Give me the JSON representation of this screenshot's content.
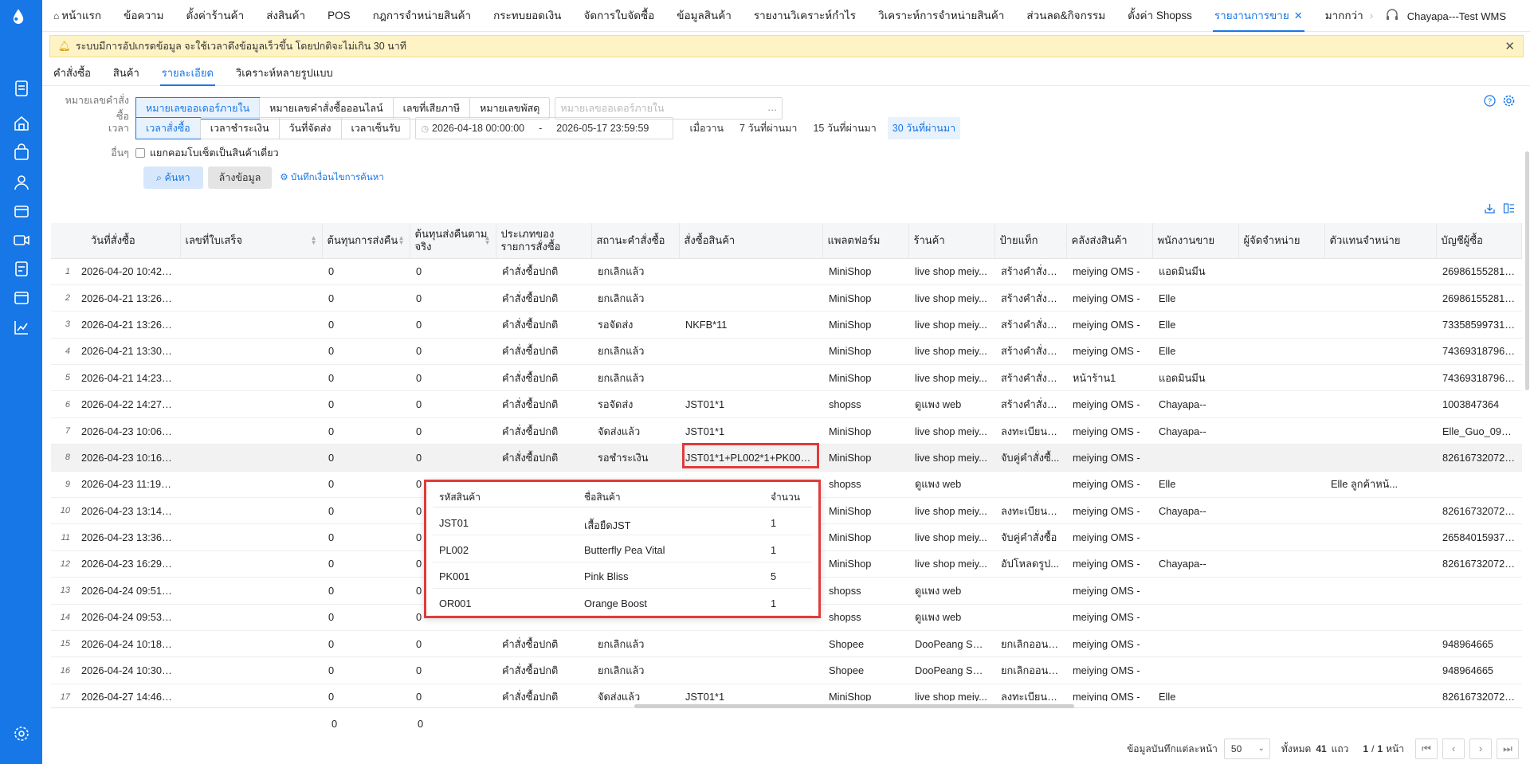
{
  "nav": {
    "items": [
      "หน้าแรก",
      "ข้อความ",
      "ตั้งค่าร้านค้า",
      "ส่งสินค้า",
      "POS",
      "กฎการจำหน่ายสินค้า",
      "กระทบยอดเงิน",
      "จัดการใบจัดซื้อ",
      "ข้อมูลสินค้า",
      "รายงานวิเคราะห์กำไร",
      "วิเคราะห์การจำหน่ายสินค้า",
      "ส่วนลด&กิจกรรม",
      "ตั้งค่า Shopss",
      "รายงานการขาย",
      "มากกว่า"
    ],
    "active": "รายงานการขาย",
    "user": "Chayapa---Test WMS"
  },
  "notice": {
    "text": "ระบบมีการอัปเกรดข้อมูล จะใช้เวลาดึงข้อมูลเร็วขึ้น โดยปกติจะไม่เกิน 30 นาที"
  },
  "subtabs": [
    "คำสั่งซื้อ",
    "สินค้า",
    "รายละเอียด",
    "วิเคราะห์หลายรูปแบบ"
  ],
  "filters": {
    "order_no_label": "หมายเลขคำสั่งซื้อ",
    "order_no_options": [
      "หมายเลขออเดอร์ภายใน",
      "หมายเลขคำสั่งซื้อออนไลน์",
      "เลขที่เสียภาษี",
      "หมายเลขพัสดุ"
    ],
    "order_no_placeholder": "หมายเลขออเดอร์ภายใน",
    "time_label": "เวลา",
    "time_options": [
      "เวลาสั่งซื้อ",
      "เวลาชำระเงิน",
      "วันที่จัดส่ง",
      "เวลาเซ็นรับ"
    ],
    "date_start": "2026-04-18 00:00:00",
    "date_sep": "-",
    "date_end": "2026-05-17 23:59:59",
    "quick": [
      "เมื่อวาน",
      "7 วันที่ผ่านมา",
      "15 วันที่ผ่านมา",
      "30 วันที่ผ่านมา"
    ],
    "other_label": "อื่นๆ",
    "combo_check": "แยกคอมโบเซ็ตเป็นสินค้าเดี่ยว",
    "search_btn": "ค้นหา",
    "reset_btn": "ล้างข้อมูล",
    "save_link": "บันทึกเงื่อนไขการค้นหา"
  },
  "table": {
    "headers": [
      "วันที่สั่งซื้อ",
      "เลขที่ใบเสร็จ",
      "ต้นทุนการส่งคืน",
      "ต้นทุนส่งคืนตามจริง",
      "ประเภทของรายการสั่งซื้อ",
      "สถานะคำสั่งซื้อ",
      "สั่งซื้อสินค้า",
      "แพลตฟอร์ม",
      "ร้านค้า",
      "ป้ายแท็ก",
      "คลังส่งสินค้า",
      "พนักงานขาย",
      "ผู้จัดจำหน่าย",
      "ตัวแทนจำหน่าย",
      "บัญชีผู้ซื้อ"
    ],
    "rows": [
      {
        "n": "1",
        "date": "2026-04-20 10:42:31",
        "rc": "0",
        "ra": "0",
        "type": "คำสั่งซื้อปกติ",
        "status": "ยกเลิกแล้ว",
        "items": "",
        "plat": "MiniShop",
        "shop": "live shop meiy...",
        "tag": "สร้างคำสั่งซื้...",
        "wh": "meiying OMS -",
        "sales": "แอดมินมีน",
        "sup": "",
        "agent": "",
        "buyer": "26986155281002628"
      },
      {
        "n": "2",
        "date": "2026-04-21 13:26:04",
        "rc": "0",
        "ra": "0",
        "type": "คำสั่งซื้อปกติ",
        "status": "ยกเลิกแล้ว",
        "items": "",
        "plat": "MiniShop",
        "shop": "live shop meiy...",
        "tag": "สร้างคำสั่งซื้...",
        "wh": "meiying OMS -",
        "sales": "Elle",
        "sup": "",
        "agent": "",
        "buyer": "26986155281002628"
      },
      {
        "n": "3",
        "date": "2026-04-21 13:26:25",
        "rc": "0",
        "ra": "0",
        "type": "คำสั่งซื้อปกติ",
        "status": "รอจัดส่ง",
        "items": "NKFB*11",
        "plat": "MiniShop",
        "shop": "live shop meiy...",
        "tag": "สร้างคำสั่งซื้...",
        "wh": "meiying OMS -",
        "sales": "Elle",
        "sup": "",
        "agent": "",
        "buyer": "7335859973170621"
      },
      {
        "n": "4",
        "date": "2026-04-21 13:30:36",
        "rc": "0",
        "ra": "0",
        "type": "คำสั่งซื้อปกติ",
        "status": "ยกเลิกแล้ว",
        "items": "",
        "plat": "MiniShop",
        "shop": "live shop meiy...",
        "tag": "สร้างคำสั่งซื้...",
        "wh": "meiying OMS -",
        "sales": "Elle",
        "sup": "",
        "agent": "",
        "buyer": "7436931879674124"
      },
      {
        "n": "5",
        "date": "2026-04-21 14:23:43",
        "rc": "0",
        "ra": "0",
        "type": "คำสั่งซื้อปกติ",
        "status": "ยกเลิกแล้ว",
        "items": "",
        "plat": "MiniShop",
        "shop": "live shop meiy...",
        "tag": "สร้างคำสั่งซื้...",
        "wh": "หน้าร้าน1",
        "sales": "แอดมินมีน",
        "sup": "",
        "agent": "",
        "buyer": "7436931879674124"
      },
      {
        "n": "6",
        "date": "2026-04-22 14:27:16",
        "rc": "0",
        "ra": "0",
        "type": "คำสั่งซื้อปกติ",
        "status": "รอจัดส่ง",
        "items": "JST01*1",
        "plat": "shopss",
        "shop": "ดูแพง web",
        "tag": "สร้างคำสั่งซื้...",
        "wh": "meiying OMS -",
        "sales": "Chayapa--",
        "sup": "",
        "agent": "",
        "buyer": "1003847364"
      },
      {
        "n": "7",
        "date": "2026-04-23 10:06:06",
        "rc": "0",
        "ra": "0",
        "type": "คำสั่งซื้อปกติ",
        "status": "จัดส่งแล้ว",
        "items": "JST01*1",
        "plat": "MiniShop",
        "shop": "live shop meiy...",
        "tag": "ลงทะเบียนแ...",
        "wh": "meiying OMS -",
        "sales": "Chayapa--",
        "sup": "",
        "agent": "",
        "buyer": "Elle_Guo_0970400..."
      },
      {
        "n": "8",
        "date": "2026-04-23 10:16:49",
        "rc": "0",
        "ra": "0",
        "type": "คำสั่งซื้อปกติ",
        "status": "รอชำระเงิน",
        "items": "JST01*1+PL002*1+PK001*...",
        "plat": "MiniShop",
        "shop": "live shop meiy...",
        "tag": "จับคู่คำสั่งซื้...",
        "wh": "meiying OMS -",
        "sales": "",
        "sup": "",
        "agent": "",
        "buyer": "8261673207224104"
      },
      {
        "n": "9",
        "date": "2026-04-23 11:19:40",
        "rc": "0",
        "ra": "0",
        "type": "",
        "status": "",
        "items": "",
        "plat": "shopss",
        "shop": "ดูแพง web",
        "tag": "",
        "wh": "meiying OMS -",
        "sales": "Elle",
        "sup": "",
        "agent": "Elle ลูกค้าหน้...",
        "buyer": ""
      },
      {
        "n": "10",
        "date": "2026-04-23 13:14:55",
        "rc": "0",
        "ra": "0",
        "type": "",
        "status": "",
        "items": "",
        "plat": "MiniShop",
        "shop": "live shop meiy...",
        "tag": "ลงทะเบียนแ...",
        "wh": "meiying OMS -",
        "sales": "Chayapa--",
        "sup": "",
        "agent": "",
        "buyer": "8261673207224104"
      },
      {
        "n": "11",
        "date": "2026-04-23 13:36:50",
        "rc": "0",
        "ra": "0",
        "type": "",
        "status": "",
        "items": "",
        "plat": "MiniShop",
        "shop": "live shop meiy...",
        "tag": "จับคู่คำสั่งซื้อ",
        "wh": "meiying OMS -",
        "sales": "",
        "sup": "",
        "agent": "",
        "buyer": "26584015937923286"
      },
      {
        "n": "12",
        "date": "2026-04-23 16:29:25",
        "rc": "0",
        "ra": "0",
        "type": "",
        "status": "",
        "items": "",
        "plat": "MiniShop",
        "shop": "live shop meiy...",
        "tag": "อัปโหลดรูป...",
        "wh": "meiying OMS -",
        "sales": "Chayapa--",
        "sup": "",
        "agent": "",
        "buyer": "8261673207224104"
      },
      {
        "n": "13",
        "date": "2026-04-24 09:51:33",
        "rc": "0",
        "ra": "0",
        "type": "",
        "status": "",
        "items": "",
        "plat": "shopss",
        "shop": "ดูแพง web",
        "tag": "",
        "wh": "meiying OMS -",
        "sales": "",
        "sup": "",
        "agent": "",
        "buyer": ""
      },
      {
        "n": "14",
        "date": "2026-04-24 09:53:09",
        "rc": "0",
        "ra": "0",
        "type": "",
        "status": "",
        "items": "",
        "plat": "shopss",
        "shop": "ดูแพง web",
        "tag": "",
        "wh": "meiying OMS -",
        "sales": "",
        "sup": "",
        "agent": "",
        "buyer": ""
      },
      {
        "n": "15",
        "date": "2026-04-24 10:18:31",
        "rc": "0",
        "ra": "0",
        "type": "คำสั่งซื้อปกติ",
        "status": "ยกเลิกแล้ว",
        "items": "",
        "plat": "Shopee",
        "shop": "DooPeang Shop",
        "tag": "ยกเลิกออนไ...",
        "wh": "meiying OMS -",
        "sales": "",
        "sup": "",
        "agent": "",
        "buyer": "948964665"
      },
      {
        "n": "16",
        "date": "2026-04-24 10:30:51",
        "rc": "0",
        "ra": "0",
        "type": "คำสั่งซื้อปกติ",
        "status": "ยกเลิกแล้ว",
        "items": "",
        "plat": "Shopee",
        "shop": "DooPeang Shop",
        "tag": "ยกเลิกออนไ...",
        "wh": "meiying OMS -",
        "sales": "",
        "sup": "",
        "agent": "",
        "buyer": "948964665"
      },
      {
        "n": "17",
        "date": "2026-04-27 14:46:59",
        "rc": "0",
        "ra": "0",
        "type": "คำสั่งซื้อปกติ",
        "status": "จัดส่งแล้ว",
        "items": "JST01*1",
        "plat": "MiniShop",
        "shop": "live shop meiy...",
        "tag": "ลงทะเบียนแ...",
        "wh": "meiying OMS -",
        "sales": "Elle",
        "sup": "",
        "agent": "",
        "buyer": "8261673207224104"
      }
    ],
    "totals": {
      "rc": "0",
      "ra": "0"
    }
  },
  "popup": {
    "headers": [
      "รหัสสินค้า",
      "ชื่อสินค้า",
      "จำนวน"
    ],
    "rows": [
      {
        "code": "JST01",
        "name": "เสื้อยืดJST",
        "qty": "1"
      },
      {
        "code": "PL002",
        "name": "Butterfly Pea Vital",
        "qty": "1"
      },
      {
        "code": "PK001",
        "name": "Pink Bliss",
        "qty": "5"
      },
      {
        "code": "OR001",
        "name": "Orange Boost",
        "qty": "1"
      }
    ]
  },
  "pager": {
    "per_page_label": "ข้อมูลบันทึกแต่ละหน้า",
    "per_page": "50",
    "total_prefix": "ทั้งหมด",
    "total": "41",
    "total_suffix": "แถว",
    "page": "1",
    "page_sep": "/",
    "pages": "1",
    "page_suffix": "หน้า"
  }
}
